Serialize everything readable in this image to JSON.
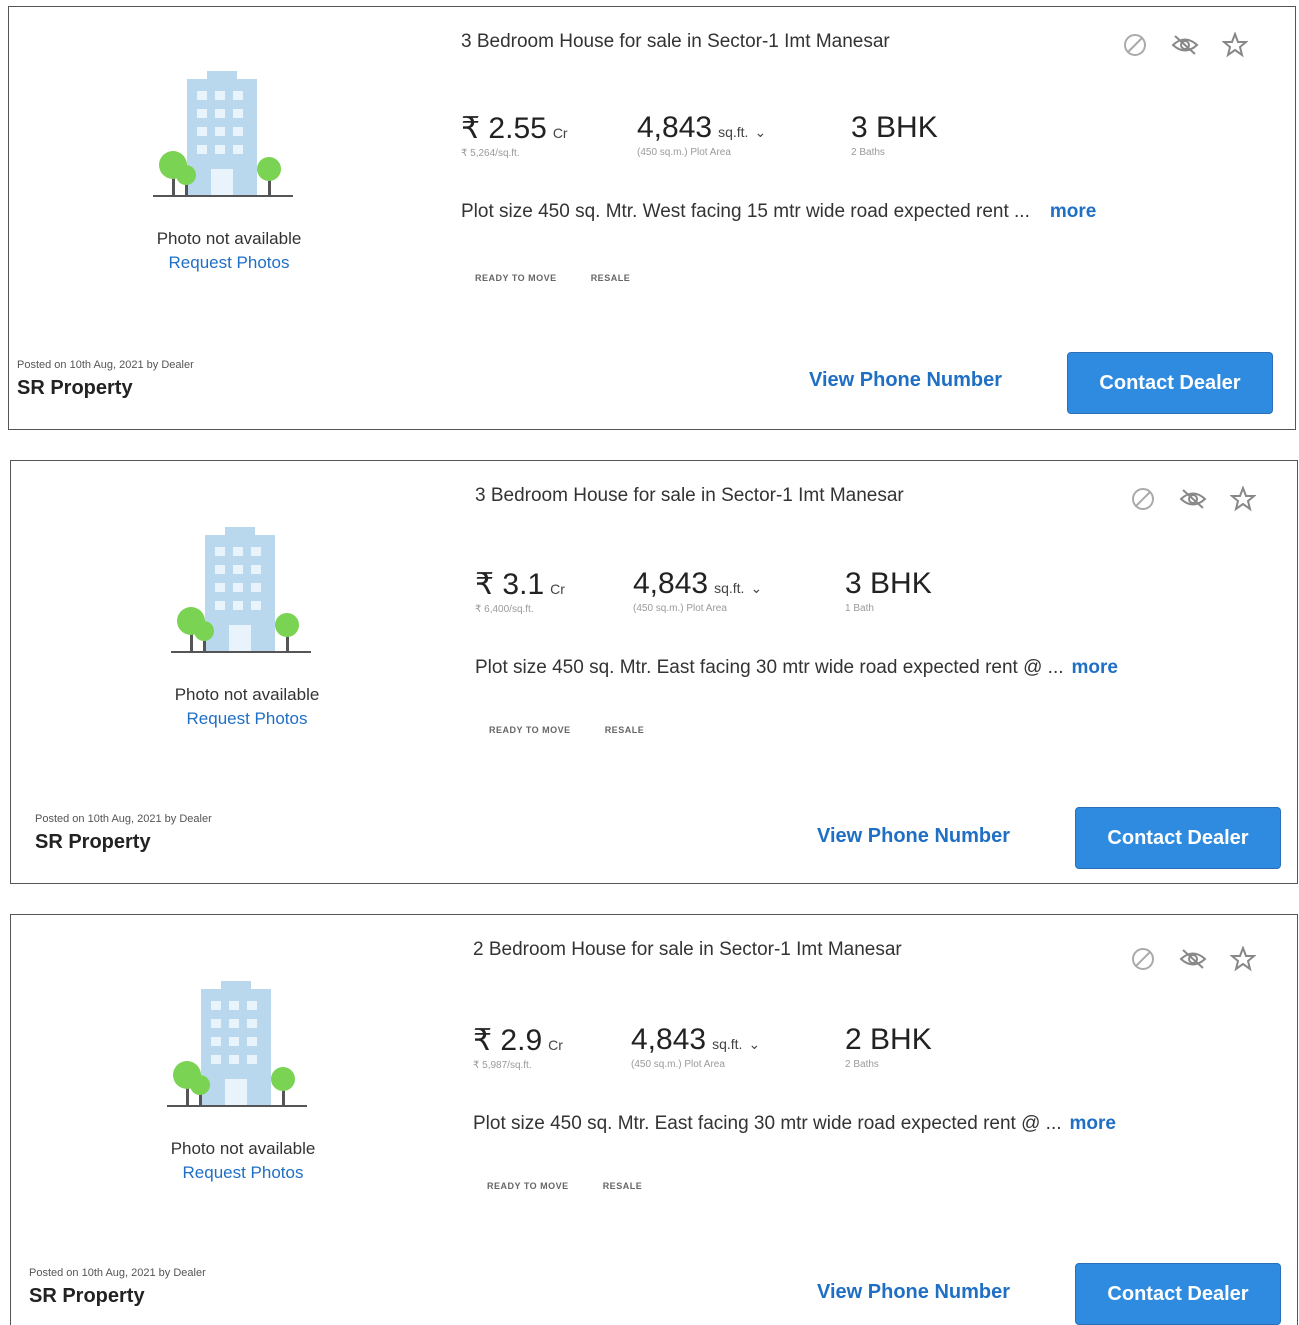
{
  "listings": [
    {
      "title": "3 Bedroom House for sale in Sector-1 Imt Manesar",
      "price": "₹ 2.55",
      "price_unit": "Cr",
      "price_per_sqft": "₹ 5,264/sq.ft.",
      "area": "4,843",
      "area_unit": "sq.ft.",
      "area_sub": "(450 sq.m.) Plot Area",
      "bhk": "3 BHK",
      "baths": "2 Baths",
      "description": "Plot size 450 sq. Mtr. West facing 15 mtr wide road expected rent ...",
      "more_label": "more",
      "tags": [
        "READY TO MOVE",
        "RESALE"
      ],
      "photo_na": "Photo not available",
      "request_photos": "Request Photos",
      "posted": "Posted on 10th Aug, 2021 by Dealer",
      "dealer": "SR Property",
      "view_phone": "View Phone Number",
      "contact": "Contact Dealer"
    },
    {
      "title": "3 Bedroom House for sale in Sector-1 Imt Manesar",
      "price": "₹ 3.1",
      "price_unit": "Cr",
      "price_per_sqft": "₹ 6,400/sq.ft.",
      "area": "4,843",
      "area_unit": "sq.ft.",
      "area_sub": "(450 sq.m.) Plot Area",
      "bhk": "3 BHK",
      "baths": "1 Bath",
      "description": "Plot size 450 sq. Mtr. East facing 30 mtr wide road expected rent @ ...",
      "more_label": "more",
      "tags": [
        "READY TO MOVE",
        "RESALE"
      ],
      "photo_na": "Photo not available",
      "request_photos": "Request Photos",
      "posted": "Posted on 10th Aug, 2021 by Dealer",
      "dealer": "SR Property",
      "view_phone": "View Phone Number",
      "contact": "Contact Dealer"
    },
    {
      "title": "2 Bedroom House for sale in Sector-1 Imt Manesar",
      "price": "₹ 2.9",
      "price_unit": "Cr",
      "price_per_sqft": "₹ 5,987/sq.ft.",
      "area": "4,843",
      "area_unit": "sq.ft.",
      "area_sub": "(450 sq.m.) Plot Area",
      "bhk": "2 BHK",
      "baths": "2 Baths",
      "description": "Plot size 450 sq. Mtr. East facing 30 mtr wide road expected rent @ ...",
      "more_label": "more",
      "tags": [
        "READY TO MOVE",
        "RESALE"
      ],
      "photo_na": "Photo not available",
      "request_photos": "Request Photos",
      "posted": "Posted on 10th Aug, 2021 by Dealer",
      "dealer": "SR Property",
      "view_phone": "View Phone Number",
      "contact": "Contact Dealer"
    }
  ],
  "icons": [
    "block-icon",
    "hide-icon",
    "star-icon",
    "building-placeholder-icon",
    "chevron-down-icon"
  ],
  "colors": {
    "accent": "#1f6fc5",
    "button": "#2f8be0",
    "building": "#b9d8ee",
    "tree": "#7ad352"
  }
}
